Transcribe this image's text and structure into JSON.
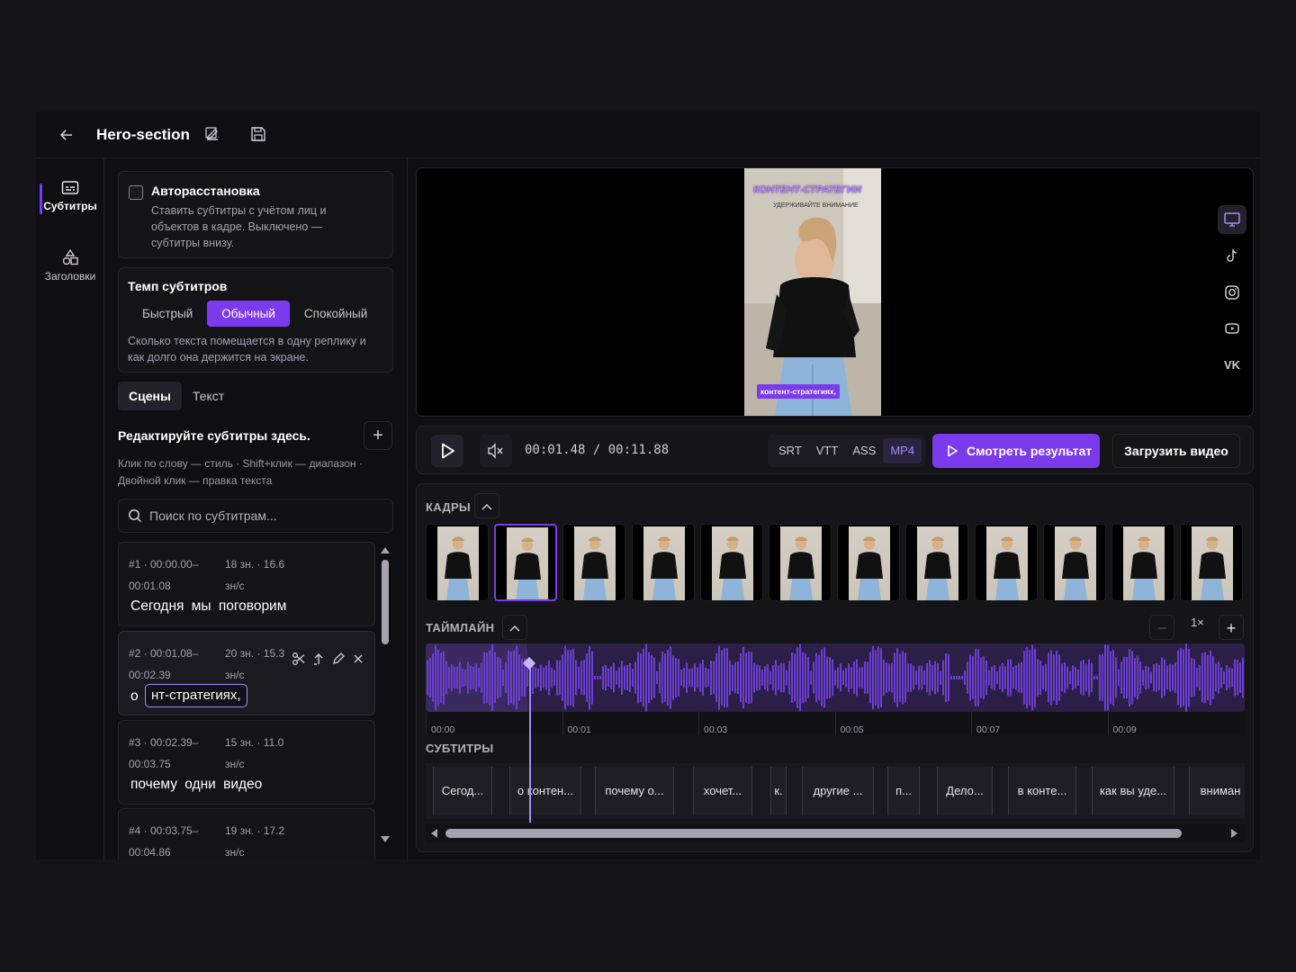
{
  "header": {
    "title": "Hero-section"
  },
  "rail": {
    "items": [
      {
        "label": "Субтитры",
        "icon": "subtitles-icon"
      },
      {
        "label": "Заголовки",
        "icon": "shapes-icon"
      }
    ]
  },
  "auto": {
    "title": "Авторасстановка",
    "desc": "Ставить субтитры с учётом лиц и объектов в кадре. Выключено — субтитры внизу."
  },
  "pace": {
    "title": "Темп субтитров",
    "options": [
      "Быстрый",
      "Обычный",
      "Спокойный"
    ],
    "selected": "Обычный",
    "desc": "Сколько текста помещается в одну реплику и как долго она держится на экране."
  },
  "tabs": [
    "Сцены",
    "Текст"
  ],
  "editor": {
    "heading": "Редактируйте субтитры здесь.",
    "add_label": "+",
    "hint": "Клик по слову — стиль · Shift+клик — диапазон · Двойной клик — правка текста",
    "search_placeholder": "Поиск по субтитрам..."
  },
  "subtitles": [
    {
      "meta1": "#1 · 00:00.00–",
      "meta1b": "00:01.08",
      "meta2": "18 зн. · 16.6",
      "meta2b": "зн/с",
      "text": "Сегодня мы поговорим"
    },
    {
      "meta1": "#2 · 00:01.08–",
      "meta1b": "00:02.39",
      "meta2": "20 зн. · 15.3",
      "meta2b": "зн/с",
      "text_prefix": "о",
      "edit_value": "нт-стратегиях,"
    },
    {
      "meta1": "#3 · 00:02.39–",
      "meta1b": "00:03.75",
      "meta2": "15 зн. · 11.0",
      "meta2b": "зн/с",
      "text": "почему одни видео"
    },
    {
      "meta1": "#4 · 00:03.75–",
      "meta1b": "00:04.86",
      "meta2": "19 зн. · 17.2",
      "meta2b": "зн/с",
      "text": ""
    }
  ],
  "video": {
    "headline": "КОНТЕНТ-СТРАТЕГИИ",
    "subline": "УДЕРЖИВАЙТЕ ВНИМАНИЕ",
    "caption": "контент-стратегиях,"
  },
  "platforms": [
    {
      "icon": "monitor-icon",
      "active": true
    },
    {
      "icon": "tiktok-icon"
    },
    {
      "icon": "instagram-icon"
    },
    {
      "icon": "youtube-icon"
    },
    {
      "label": "VK",
      "icon": "vk-icon"
    }
  ],
  "player": {
    "time": "00:01.48 / 00:11.88",
    "formats": [
      "SRT",
      "VTT",
      "ASS",
      "MP4"
    ],
    "format_selected": "MP4",
    "watch_label": "Смотреть результат",
    "upload_label": "Загрузить видео"
  },
  "timeline": {
    "frames_label": "КАДРЫ",
    "timeline_label": "ТАЙМЛАЙН",
    "subs_label": "СУБТИТРЫ",
    "zoom": "1×",
    "ticks": [
      "00:00",
      "00:01",
      "00:03",
      "00:05",
      "00:07",
      "00:09"
    ],
    "chips": [
      "Сегод...",
      "о контен...",
      "почему о...",
      "хочет...",
      "к.",
      "другие ...",
      "п...",
      "Дело...",
      "в конте...",
      "как вы уде...",
      "вниман"
    ]
  },
  "colors": {
    "accent": "#7c3aed",
    "accent_light": "#a78bfa",
    "bg": "#0f0e12"
  }
}
